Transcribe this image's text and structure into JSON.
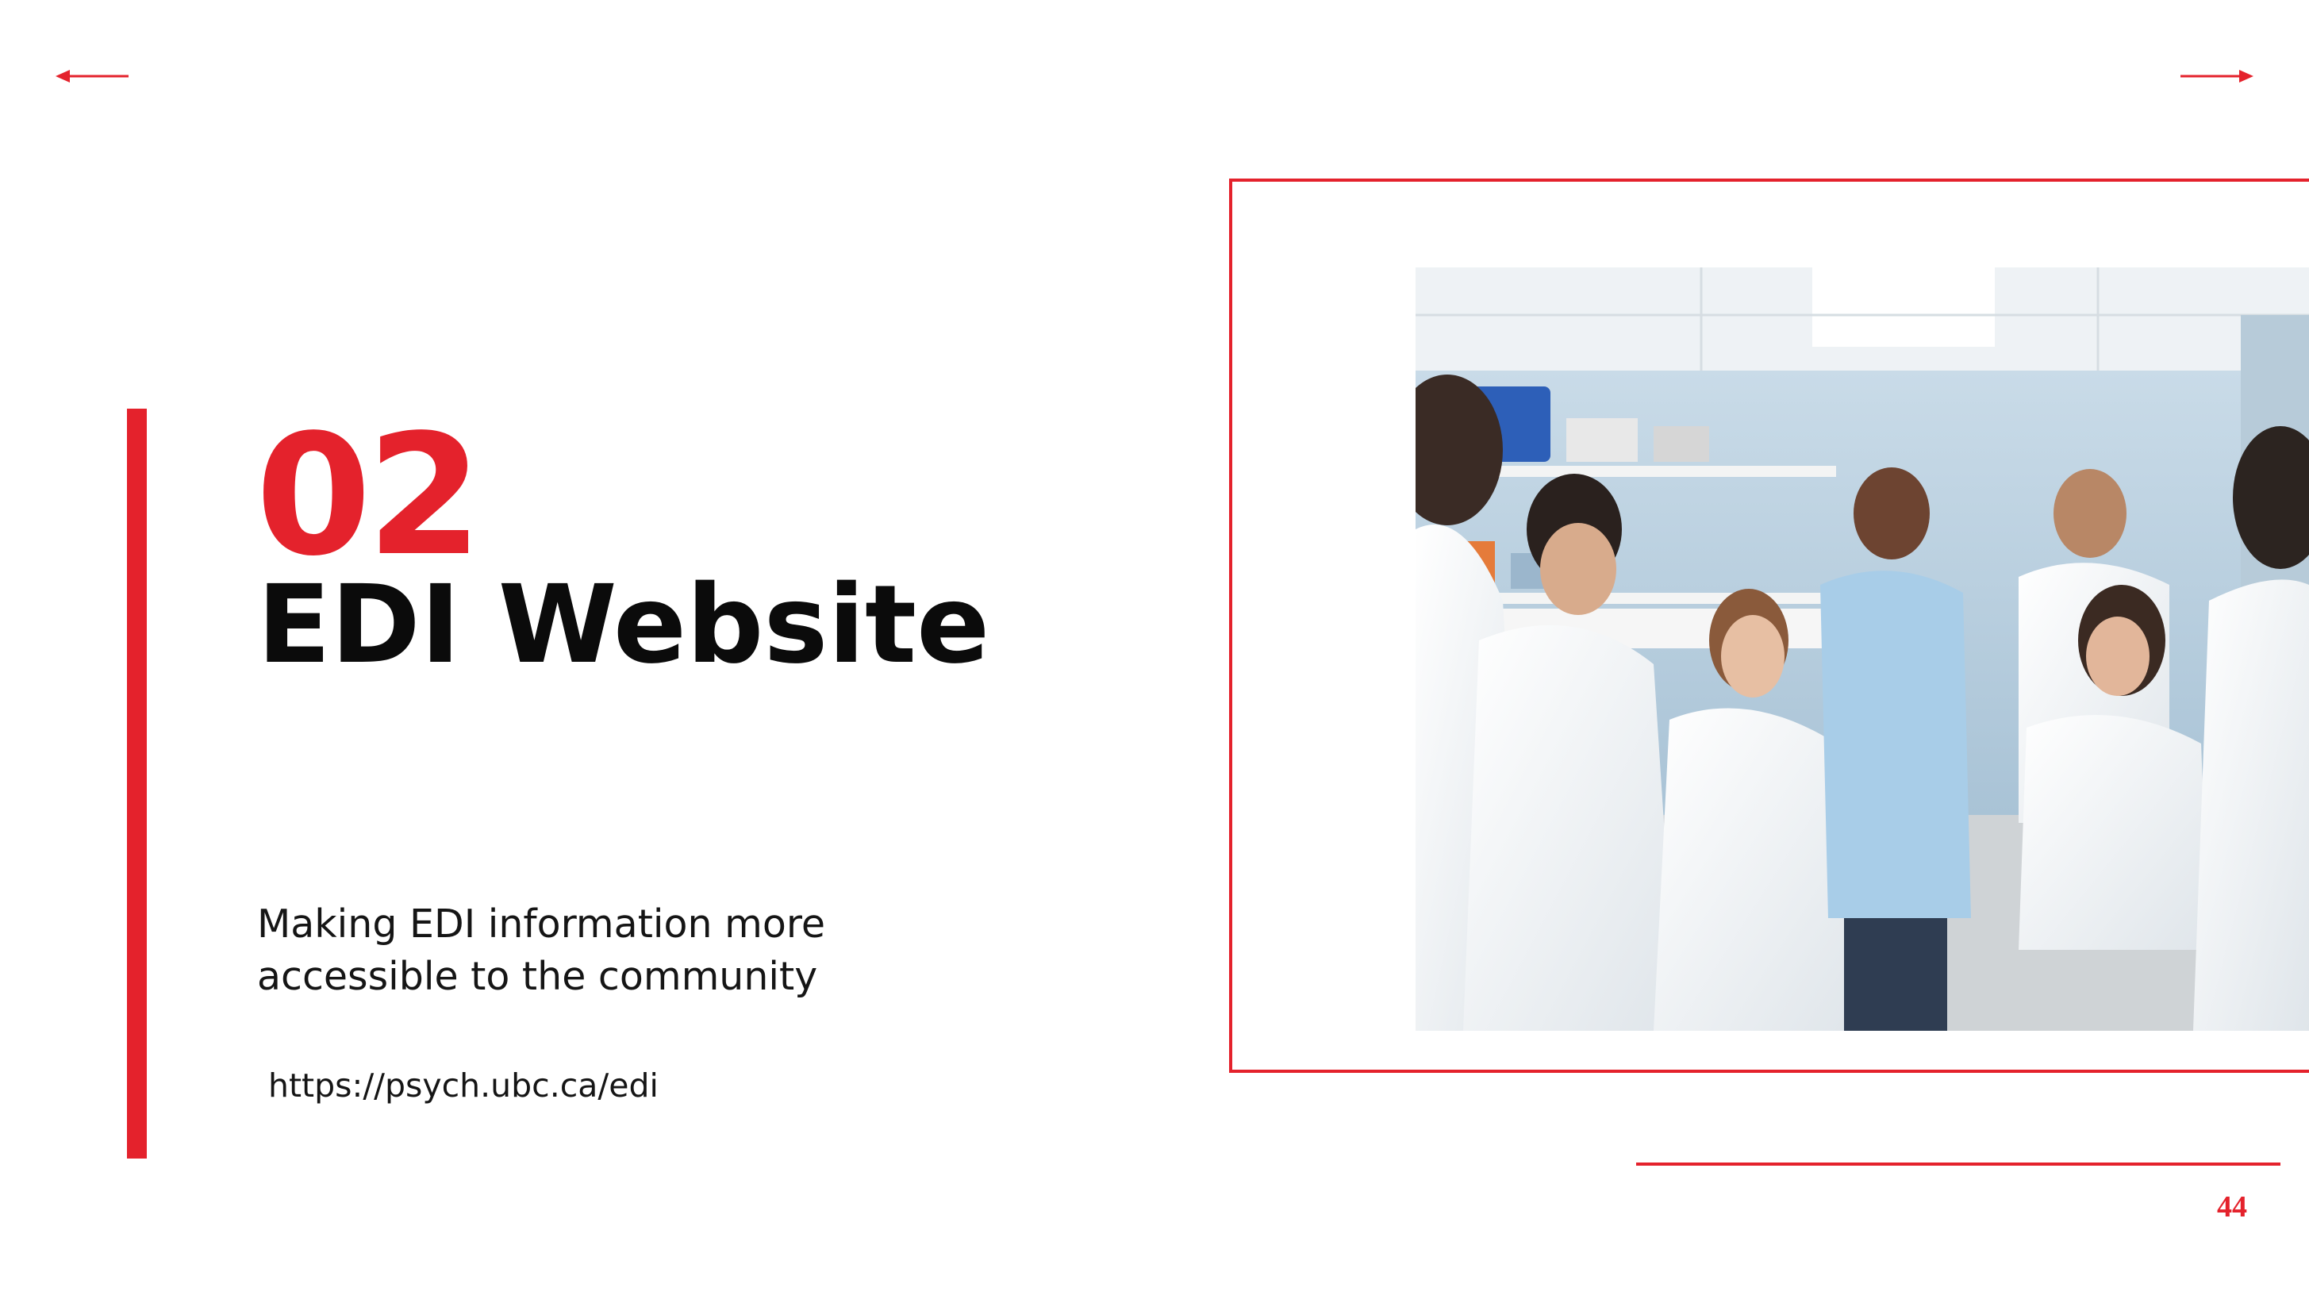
{
  "slide": {
    "section_number": "02",
    "title": "EDI Website",
    "subtitle": "Making EDI information more accessible to the community",
    "url": "https://psych.ubc.ca/edi",
    "page_number": "44"
  },
  "navigation": {
    "back_icon": "left-arrow-icon",
    "next_icon": "right-arrow-icon"
  },
  "photo": {
    "subject": "lab-group-photo"
  },
  "colors": {
    "accent": "#e4222c",
    "text": "#0b0b0b",
    "background": "#ffffff"
  }
}
